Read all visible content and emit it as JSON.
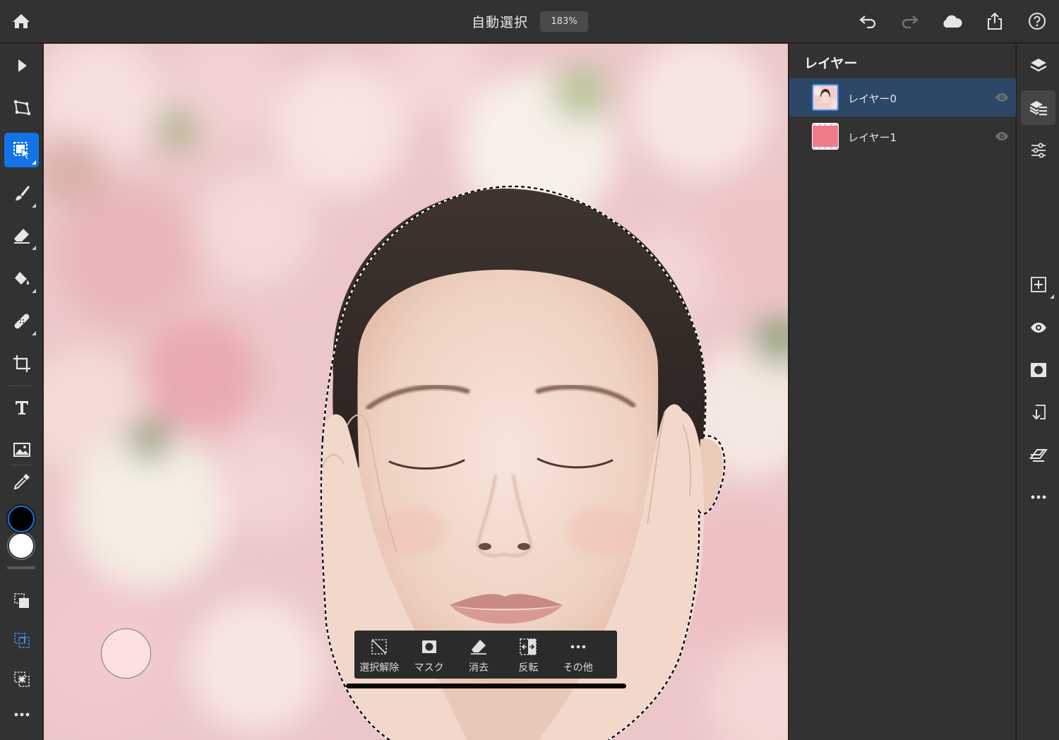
{
  "app": {
    "title": "自動選択",
    "zoom": "183%"
  },
  "topbar_icons": [
    "home-icon",
    "undo-icon",
    "redo-icon",
    "cloud-icon",
    "share-icon",
    "help-icon"
  ],
  "left_tools": [
    "select-icon",
    "transform-icon",
    "selection-tool-icon",
    "brush-icon",
    "eraser-icon",
    "fill-icon",
    "healing-icon",
    "crop-icon",
    "type-icon",
    "place-image-icon",
    "eyedropper-icon"
  ],
  "left_tools_active": "selection-tool-icon",
  "colors": {
    "foreground": "#000000",
    "background": "#ffffff",
    "accent": "#1473e6",
    "layer_selected_bg": "#2c4866",
    "layer1_fill": "#f07b8a"
  },
  "selection_modes": [
    "add-selection-icon",
    "subtract-selection-icon",
    "intersect-selection-icon"
  ],
  "selection_bar": {
    "items": [
      {
        "label": "選択解除",
        "icon": "deselect-icon"
      },
      {
        "label": "マスク",
        "icon": "mask-icon"
      },
      {
        "label": "消去",
        "icon": "erase-icon"
      },
      {
        "label": "反転",
        "icon": "invert-icon"
      },
      {
        "label": "その他",
        "icon": "more-icon"
      }
    ]
  },
  "layers_panel": {
    "title": "レイヤー",
    "layers": [
      {
        "name": "レイヤー0",
        "selected": true,
        "visible": true
      },
      {
        "name": "レイヤー1",
        "selected": false,
        "visible": true
      }
    ]
  },
  "right_rail": [
    "layers-icon",
    "layer-properties-icon",
    "adjustments-icon",
    "add-layer-icon",
    "visibility-icon",
    "mask-icon",
    "import-icon",
    "clipping-icon",
    "more-icon"
  ],
  "right_rail_active": "layer-properties-icon"
}
